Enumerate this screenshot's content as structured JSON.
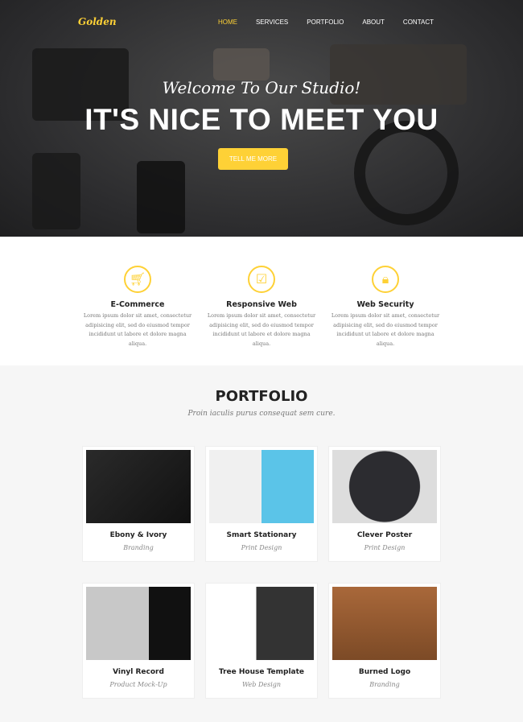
{
  "nav": {
    "logo": "Golden",
    "items": [
      {
        "label": "HOME",
        "active": true
      },
      {
        "label": "SERVICES"
      },
      {
        "label": "PORTFOLIO"
      },
      {
        "label": "ABOUT"
      },
      {
        "label": "CONTACT"
      }
    ]
  },
  "hero": {
    "subtitle": "Welcome To Our Studio!",
    "title": "IT'S NICE TO MEET YOU",
    "button": "TELL ME MORE"
  },
  "services": [
    {
      "icon": "basket-icon",
      "title": "E-Commerce",
      "text": "Lorem ipsum dolor sit amet, consectetur adipisicing elit, sed do eiusmod tempor incididunt ut labore et dolore magna aliqua."
    },
    {
      "icon": "laptop-check-icon",
      "title": "Responsive Web",
      "text": "Lorem ipsum dolor sit amet, consectetur adipisicing elit, sed do eiusmod tempor incididunt ut labore et dolore magna aliqua."
    },
    {
      "icon": "lock-icon",
      "title": "Web Security",
      "text": "Lorem ipsum dolor sit amet, consectetur adipisicing elit, sed do eiusmod tempor incididunt ut labore et dolore magna aliqua."
    }
  ],
  "portfolio": {
    "title": "PORTFOLIO",
    "subtitle": "Proin iaculis purus consequat sem cure.",
    "items": [
      {
        "title": "Ebony & Ivory",
        "category": "Branding"
      },
      {
        "title": "Smart Stationary",
        "category": "Print Design"
      },
      {
        "title": "Clever Poster",
        "category": "Print Design"
      },
      {
        "title": "Vinyl Record",
        "category": "Product Mock-Up"
      },
      {
        "title": "Tree House Template",
        "category": "Web Design"
      },
      {
        "title": "Burned Logo",
        "category": "Branding"
      }
    ]
  },
  "colors": {
    "accent": "#fed136"
  }
}
